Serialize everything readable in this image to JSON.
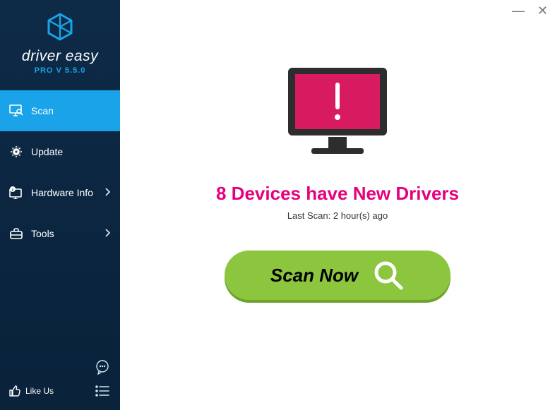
{
  "brand": {
    "name": "driver easy",
    "version_line": "PRO V 5.5.0"
  },
  "nav": {
    "scan": {
      "label": "Scan"
    },
    "update": {
      "label": "Update"
    },
    "hw": {
      "label": "Hardware Info"
    },
    "tools": {
      "label": "Tools"
    }
  },
  "sidebar_bottom": {
    "likeus": "Like Us"
  },
  "window": {
    "minimize": "―",
    "close": "✕"
  },
  "main": {
    "headline": "8 Devices have New Drivers",
    "subtext": "Last Scan: 2 hour(s) ago",
    "scan_button": "Scan Now"
  }
}
